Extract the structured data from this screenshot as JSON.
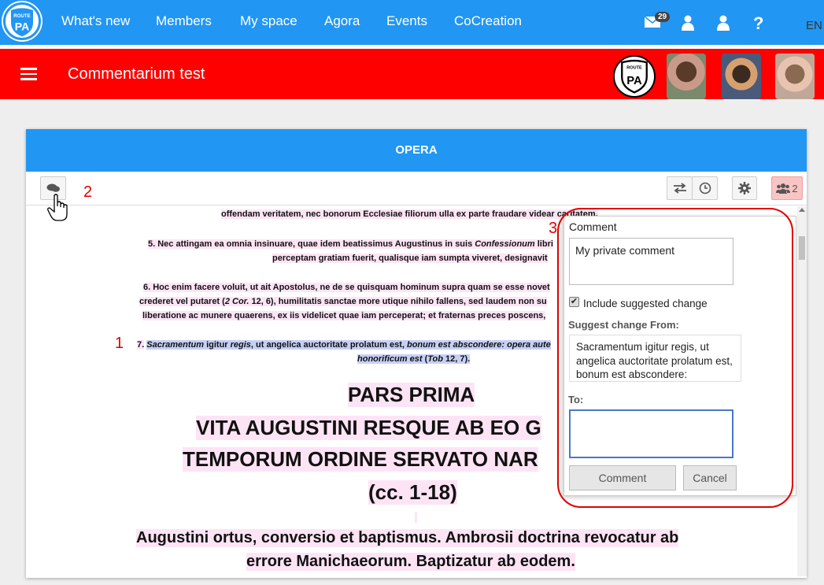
{
  "nav": {
    "logo_text": "ROUTE TO PA",
    "links": [
      "What's new",
      "Members",
      "My space",
      "Agora",
      "Events",
      "CoCreation"
    ],
    "mail_count": "29",
    "help": "?",
    "lang": "EN"
  },
  "header": {
    "menu_icon": "hamburger-icon",
    "title": "Commentarium test"
  },
  "card": {
    "title": "OPERA",
    "toolbar": {
      "comment_icon": "comments-icon",
      "swap_icon": "swap-icon",
      "history_icon": "clock-icon",
      "settings_icon": "gear-icon",
      "users_count": "2"
    }
  },
  "doc": {
    "lines": [
      "offendam veritatem, nec bonorum Ecclesiae filiorum ulla ex parte fraudare videar caritatem.",
      "5. Nec attingam ea omnia insinuare, quae idem beatissimus Augustinus in suis",
      "Confessionum",
      "libri",
      "perceptam gratiam fuerit, qualisque iam sumpta viveret, designavit",
      "6. Hoc enim facere voluit, ut ait Apostolus, ne de se quisquam hominum supra quam se esse novet",
      "crederet vel putaret (",
      "2 Cor.",
      "12, 6), humilitatis sanctae more utique nihilo fallens, sed laudem non su",
      "liberatione ac munere quaerens, ex iis videlicet quae iam perceperat; et fraternas preces poscens,",
      "7.",
      "Sacramentum",
      " igitur ",
      "regis",
      ", ut angelica auctoritate prolatum est, ",
      "bonum est abscondere: opera aute",
      "honorificum est",
      " (",
      "Tob",
      " 12, 7)."
    ],
    "heading": [
      "PARS PRIMA",
      "VITA AUGUSTINI RESQUE AB EO G",
      "TEMPORUM ORDINE SERVATO NAR",
      "(cc. 1-18)"
    ],
    "subheading": [
      "Augustini ortus, conversio et baptismus. Ambrosii doctrina revocatur ab",
      "errore Manichaeorum. Baptizatur ab eodem."
    ]
  },
  "annotations": [
    "1",
    "2",
    "3"
  ],
  "popover": {
    "comment_label": "Comment",
    "comment_value": "My private comment",
    "include_label": "Include suggested change",
    "include_checked": true,
    "from_label": "Suggest change From:",
    "from_value": "Sacramentum igitur regis, ut angelica auctoritate prolatum est, bonum est abscondere:",
    "to_label": "To:",
    "to_value": "",
    "comment_button": "Comment",
    "cancel_button": "Cancel"
  },
  "colors": {
    "nav_blue": "#2196f3",
    "header_red": "#ff0000",
    "pink_highlight": "#fde4f5",
    "selection_blue": "#c6d0f5",
    "annotation_red": "#e00000"
  }
}
